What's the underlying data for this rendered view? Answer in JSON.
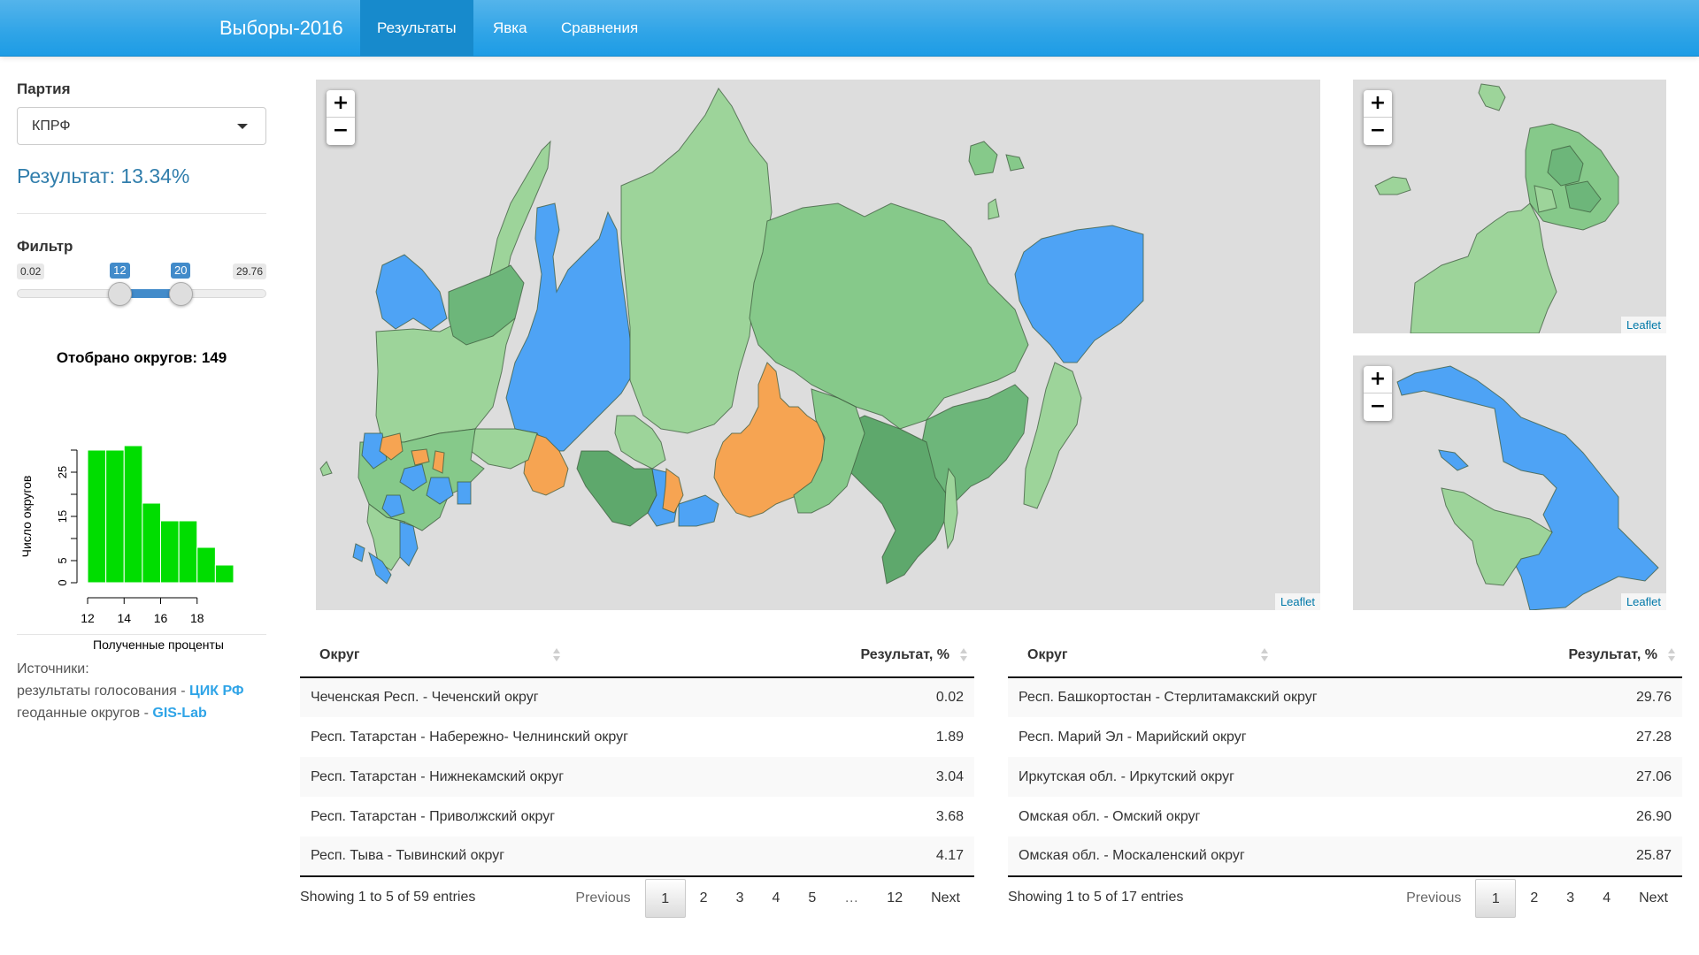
{
  "navbar": {
    "brand": "Выборы-2016",
    "tabs": [
      {
        "label": "Результаты",
        "active": true
      },
      {
        "label": "Явка",
        "active": false
      },
      {
        "label": "Сравнения",
        "active": false
      }
    ],
    "gradient_top": "#54b4eb",
    "gradient_bottom": "#2fa4e7",
    "active_color": "#178acc"
  },
  "sidebar": {
    "party_label": "Партия",
    "party_selected": "КПРФ",
    "result_text": "Результат: 13.34%",
    "filter_label": "Фильтр",
    "slider": {
      "min": 0.02,
      "max": 29.76,
      "from": 12,
      "to": 20,
      "min_label": "0.02",
      "max_label": "29.76",
      "from_label": "12",
      "to_label": "20"
    },
    "selected_title": "Отобрано округов: 149",
    "sources": {
      "heading": "Источники:",
      "line1_text": "результаты голосования - ",
      "line1_link": "ЦИК РФ",
      "line2_text": "геоданные округов - ",
      "line2_link": "GIS-Lab"
    }
  },
  "chart_data": {
    "type": "bar",
    "title": "Отобрано округов: 149",
    "xlabel": "Полученные проценты",
    "ylabel": "Число округов",
    "bin_edges": [
      12,
      13,
      14,
      15,
      16,
      17,
      18,
      19,
      20
    ],
    "values": [
      30,
      30,
      31,
      18,
      14,
      14,
      8,
      4
    ],
    "xticks": [
      12,
      14,
      16,
      18
    ],
    "yticks": [
      0,
      5,
      10,
      15,
      20,
      25,
      30
    ],
    "ytick_labels": [
      "0",
      "5",
      "",
      "15",
      "",
      "25",
      ""
    ],
    "ylim": [
      0,
      31
    ],
    "color": "#00dd00",
    "grid": false
  },
  "maps": {
    "legend_colors": {
      "below_range": "#4ea3f5",
      "in_range_light": "#9dd49a",
      "in_range_mid": "#86c98a",
      "in_range_dark": "#6db67a",
      "above_range": "#f6a452",
      "background": "#dddddd"
    },
    "main": {
      "zoom_in": "+",
      "zoom_out": "−",
      "attribution": "Leaflet"
    },
    "moscow": {
      "zoom_in": "+",
      "zoom_out": "−",
      "attribution": "Leaflet"
    },
    "spb": {
      "zoom_in": "+",
      "zoom_out": "−",
      "attribution": "Leaflet"
    }
  },
  "table_low": {
    "columns": [
      "Округ",
      "Результат, %"
    ],
    "rows": [
      {
        "district": "Чеченская Респ. - Чеченский округ",
        "value": "0.02"
      },
      {
        "district": "Респ. Татарстан - Набережно- Челнинский округ",
        "value": "1.89"
      },
      {
        "district": "Респ. Татарстан - Нижнекамский округ",
        "value": "3.04"
      },
      {
        "district": "Респ. Татарстан - Приволжский округ",
        "value": "3.68"
      },
      {
        "district": "Респ. Тыва - Тывинский округ",
        "value": "4.17"
      }
    ],
    "info": "Showing 1 to 5 of 59 entries",
    "pager": [
      "Previous",
      "1",
      "2",
      "3",
      "4",
      "5",
      "…",
      "12",
      "Next"
    ],
    "current_page": "1"
  },
  "table_high": {
    "columns": [
      "Округ",
      "Результат, %"
    ],
    "rows": [
      {
        "district": "Респ. Башкортостан - Стерлитамакский округ",
        "value": "29.76"
      },
      {
        "district": "Респ. Марий Эл - Марийский округ",
        "value": "27.28"
      },
      {
        "district": "Иркутская обл. - Иркутский округ",
        "value": "27.06"
      },
      {
        "district": "Омская обл. - Омский округ",
        "value": "26.90"
      },
      {
        "district": "Омская обл. - Москаленский округ",
        "value": "25.87"
      }
    ],
    "info": "Showing 1 to 5 of 17 entries",
    "pager": [
      "Previous",
      "1",
      "2",
      "3",
      "4",
      "Next"
    ],
    "current_page": "1"
  }
}
